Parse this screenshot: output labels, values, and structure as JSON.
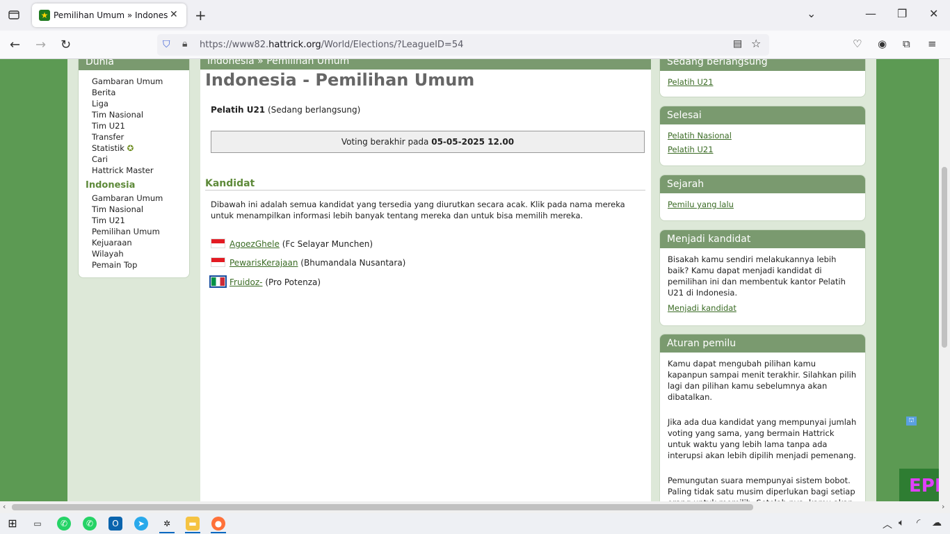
{
  "browser": {
    "tab_title": "Pemilihan Umum » Indonesia »",
    "url_prefix": "https://www82.",
    "url_domain": "hattrick.org",
    "url_path": "/World/Elections/?LeagueID=54"
  },
  "leftnav": {
    "header": "Dunia",
    "world_items": [
      "Gambaran Umum",
      "Berita",
      "Liga",
      "Tim Nasional",
      "Tim U21",
      "Transfer",
      "Statistik",
      "Cari",
      "Hattrick Master"
    ],
    "country_header": "Indonesia",
    "country_items": [
      "Gambaran Umum",
      "Tim Nasional",
      "Tim U21",
      "Pemilihan Umum",
      "Kejuaraan",
      "Wilayah",
      "Pemain Top"
    ]
  },
  "main": {
    "breadcrumb_country": "Indonesia",
    "breadcrumb_sep": "»",
    "breadcrumb_page": "Pemilihan Umum",
    "title": "Indonesia - Pemilihan Umum",
    "election_name": "Pelatih U21",
    "election_status": "(Sedang berlangsung)",
    "voting_label": "Voting berakhir pada",
    "voting_end": "05-05-2025 12.00",
    "kandidat_header": "Kandidat",
    "kandidat_desc": "Dibawah ini adalah semua kandidat yang tersedia yang diurutkan secara acak. Klik pada nama mereka untuk menampilkan informasi lebih banyak tentang mereka dan untuk bisa memilih mereka.",
    "candidates": [
      {
        "name": "AgoezGhele",
        "team": "(Fc Selayar Munchen)"
      },
      {
        "name": "PewarisKerajaan",
        "team": "(Bhumandala Nusantara)"
      },
      {
        "name": "Fruidoz-",
        "team": "(Pro Potenza)"
      }
    ]
  },
  "right": {
    "ongoing": {
      "header": "Sedang berlangsung",
      "links": [
        "Pelatih U21"
      ]
    },
    "finished": {
      "header": "Selesai",
      "links": [
        "Pelatih Nasional",
        "Pelatih U21"
      ]
    },
    "history": {
      "header": "Sejarah",
      "links": [
        "Pemilu yang lalu"
      ]
    },
    "become": {
      "header": "Menjadi kandidat",
      "text": "Bisakah kamu sendiri melakukannya lebih baik? Kamu dapat menjadi kandidat di pemilihan ini dan membentuk kantor Pelatih U21 di Indonesia.",
      "link": "Menjadi kandidat"
    },
    "rules": {
      "header": "Aturan pemilu",
      "p1": "Kamu dapat mengubah pilihan kamu kapanpun sampai menit terakhir. Silahkan pilih lagi dan pilihan kamu sebelumnya akan dibatalkan.",
      "p2": "Jika ada dua kandidat yang mempunyai jumlah voting yang sama, yang bermain Hattrick untuk waktu yang lebih lama tanpa ada interupsi akan lebih dipilih menjadi pemenang.",
      "p3": "Pemungutan suara mempunyai sistem bobot. Paling tidak satu musim diperlukan bagi setiap orang untuk memilih. Setelah nya, kamu akan"
    }
  },
  "ad_text": "EPI"
}
